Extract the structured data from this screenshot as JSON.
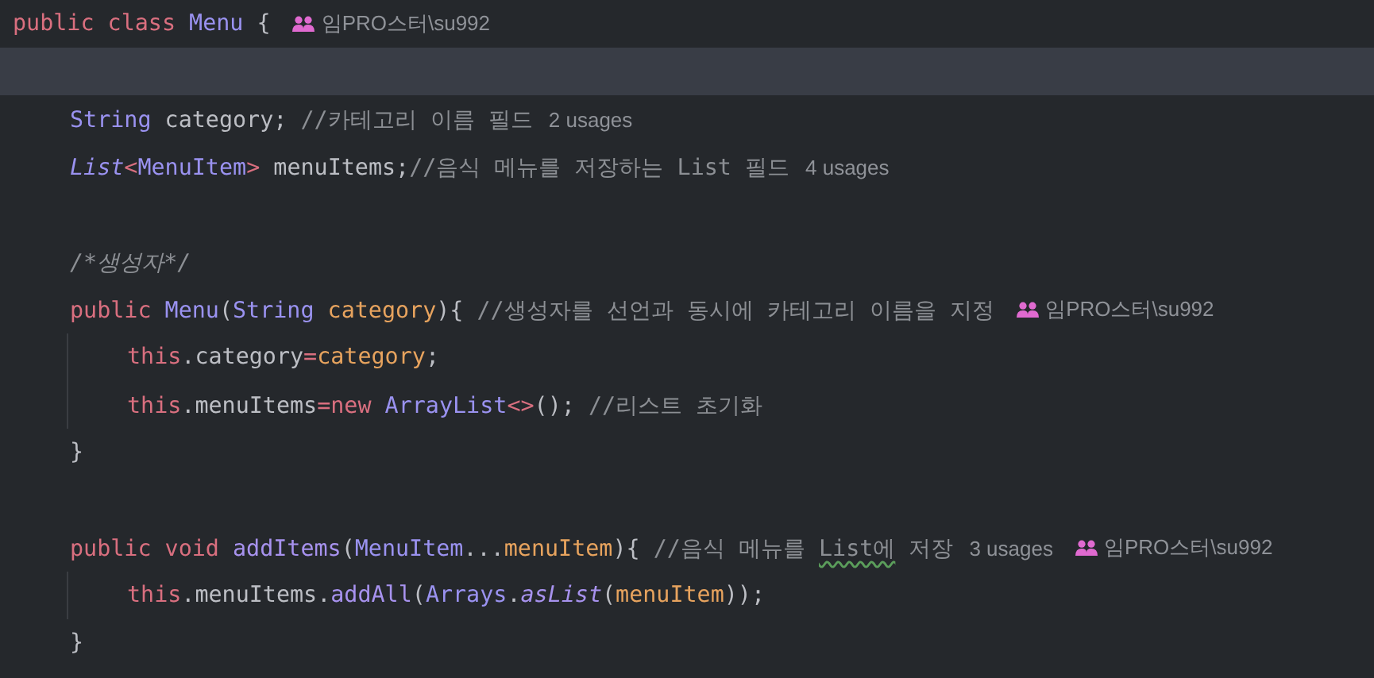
{
  "editor": {
    "lines": [
      {
        "current": false,
        "tokens": [
          {
            "kind": "keyword",
            "text": "public"
          },
          {
            "kind": "keyword",
            "text": " class"
          },
          {
            "kind": "type",
            "text": " Menu"
          },
          {
            "kind": "plain",
            "text": " {"
          }
        ],
        "hints": [
          {
            "kind": "author",
            "text": "임PRO스터\\su992"
          }
        ],
        "children": [
          {
            "current": true
          },
          {
            "current": false,
            "tokens": [
              {
                "kind": "type",
                "text": "String"
              },
              {
                "kind": "plain",
                "text": " category; "
              },
              {
                "kind": "comment",
                "text": "//카테고리 이름 필드"
              }
            ],
            "hints": [
              {
                "kind": "usages",
                "text": "2 usages"
              }
            ]
          },
          {
            "current": false,
            "tokens": [
              {
                "kind": "type-italic",
                "text": "List"
              },
              {
                "kind": "operator",
                "text": "<"
              },
              {
                "kind": "type",
                "text": "MenuItem"
              },
              {
                "kind": "operator",
                "text": ">"
              },
              {
                "kind": "plain",
                "text": " menuItems;"
              },
              {
                "kind": "comment",
                "text": "//음식 메뉴를 저장하는 List 필드"
              }
            ],
            "hints": [
              {
                "kind": "usages",
                "text": "4 usages"
              }
            ]
          },
          {
            "current": false
          },
          {
            "current": false,
            "tokens": [
              {
                "kind": "comment-italic",
                "text": "/*생성자*/"
              }
            ]
          },
          {
            "current": false,
            "tokens": [
              {
                "kind": "keyword",
                "text": "public"
              },
              {
                "kind": "type",
                "text": " Menu"
              },
              {
                "kind": "plain",
                "text": "("
              },
              {
                "kind": "type",
                "text": "String"
              },
              {
                "kind": "param",
                "text": " category"
              },
              {
                "kind": "plain",
                "text": "){ "
              },
              {
                "kind": "comment",
                "text": "//생성자를 선언과 동시에 카테고리 이름을 지정"
              }
            ],
            "hints": [
              {
                "kind": "author",
                "text": "임PRO스터\\su992"
              }
            ],
            "children": [
              {
                "current": false,
                "tokens": [
                  {
                    "kind": "keyword",
                    "text": "this"
                  },
                  {
                    "kind": "plain",
                    "text": ".category"
                  },
                  {
                    "kind": "operator",
                    "text": "="
                  },
                  {
                    "kind": "param",
                    "text": "category"
                  },
                  {
                    "kind": "plain",
                    "text": ";"
                  }
                ]
              },
              {
                "current": false,
                "tokens": [
                  {
                    "kind": "keyword",
                    "text": "this"
                  },
                  {
                    "kind": "plain",
                    "text": ".menuItems"
                  },
                  {
                    "kind": "operator",
                    "text": "="
                  },
                  {
                    "kind": "keyword",
                    "text": "new"
                  },
                  {
                    "kind": "type",
                    "text": " ArrayList"
                  },
                  {
                    "kind": "operator",
                    "text": "<>"
                  },
                  {
                    "kind": "plain",
                    "text": "(); "
                  },
                  {
                    "kind": "comment",
                    "text": "//리스트 초기화"
                  }
                ]
              }
            ]
          },
          {
            "current": false,
            "tokens": [
              {
                "kind": "plain",
                "text": "}"
              }
            ]
          },
          {
            "current": false
          },
          {
            "current": false,
            "tokens": [
              {
                "kind": "keyword",
                "text": "public"
              },
              {
                "kind": "keyword",
                "text": " void"
              },
              {
                "kind": "method",
                "text": " addItems"
              },
              {
                "kind": "plain",
                "text": "("
              },
              {
                "kind": "type",
                "text": "MenuItem"
              },
              {
                "kind": "plain",
                "text": "..."
              },
              {
                "kind": "param",
                "text": "menuItem"
              },
              {
                "kind": "plain",
                "text": "){ "
              },
              {
                "kind": "comment",
                "text": "//음식 메뉴를 "
              },
              {
                "kind": "typo",
                "text": "List에"
              },
              {
                "kind": "comment",
                "text": " 저장"
              }
            ],
            "hints": [
              {
                "kind": "usages",
                "text": "3 usages"
              },
              {
                "kind": "author",
                "text": "임PRO스터\\su992"
              }
            ],
            "children": [
              {
                "current": false,
                "tokens": [
                  {
                    "kind": "keyword",
                    "text": "this"
                  },
                  {
                    "kind": "plain",
                    "text": ".menuItems."
                  },
                  {
                    "kind": "method",
                    "text": "addAll"
                  },
                  {
                    "kind": "plain",
                    "text": "("
                  },
                  {
                    "kind": "type",
                    "text": "Arrays"
                  },
                  {
                    "kind": "plain",
                    "text": "."
                  },
                  {
                    "kind": "method-italic",
                    "text": "asList"
                  },
                  {
                    "kind": "plain",
                    "text": "("
                  },
                  {
                    "kind": "param",
                    "text": "menuItem"
                  },
                  {
                    "kind": "plain",
                    "text": "));"
                  }
                ]
              }
            ]
          },
          {
            "current": false,
            "tokens": [
              {
                "kind": "plain",
                "text": "}"
              }
            ]
          }
        ]
      }
    ]
  }
}
